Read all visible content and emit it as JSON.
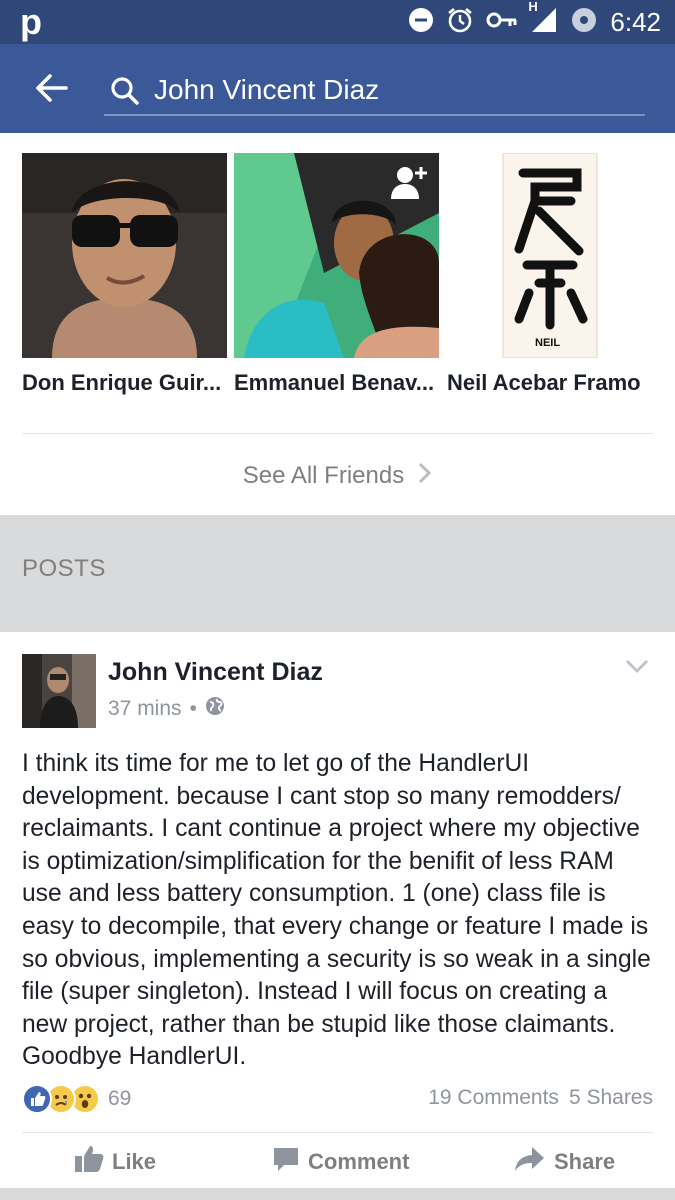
{
  "status_bar": {
    "app_glyph": "p",
    "time": "6:42",
    "network_label": "H",
    "icons": [
      "minus-circle-icon",
      "alarm-icon",
      "vpn-key-icon",
      "signal-icon",
      "data-saver-icon"
    ]
  },
  "search": {
    "query": "John Vincent Diaz",
    "back_icon": "arrow-left-icon",
    "search_icon": "search-icon"
  },
  "friends": {
    "items": [
      {
        "name": "Don Enrique Guir..."
      },
      {
        "name": "Emmanuel Benav...",
        "badge_icon": "add-friend-icon"
      },
      {
        "name": "Neil Acebar Framo",
        "photo_caption": "NEIL"
      }
    ],
    "see_all_label": "See All Friends"
  },
  "posts_section": {
    "title": "POSTS"
  },
  "post": {
    "author": "John Vincent Diaz",
    "time": "37 mins",
    "separator": "•",
    "privacy_icon": "globe-icon",
    "text": "I think its time for me to let go of the HandlerUI development. because I cant stop so many remodders/ reclaimants. I cant continue a project where my objective is optimization/simplification for the benifit of less RAM use and less battery consumption. 1 (one) class file is easy to decompile, that every change or feature I made is so obvious, implementing a security is so weak in a single file (super singleton). Instead I will focus on creating a new project, rather than be stupid like those claimants. Goodbye HandlerUI.",
    "reactions": [
      "like-reaction-icon",
      "sad-reaction-icon",
      "wow-reaction-icon"
    ],
    "reaction_count": "69",
    "comments": "19 Comments",
    "shares": "5 Shares",
    "actions": {
      "like": "Like",
      "comment": "Comment",
      "share": "Share"
    }
  },
  "colors": {
    "header_blue": "#3b5998",
    "status_blue": "#2f4779",
    "section_gray": "#d9dadc",
    "meta_gray": "#90949c",
    "like_blue": "#4267b2"
  }
}
